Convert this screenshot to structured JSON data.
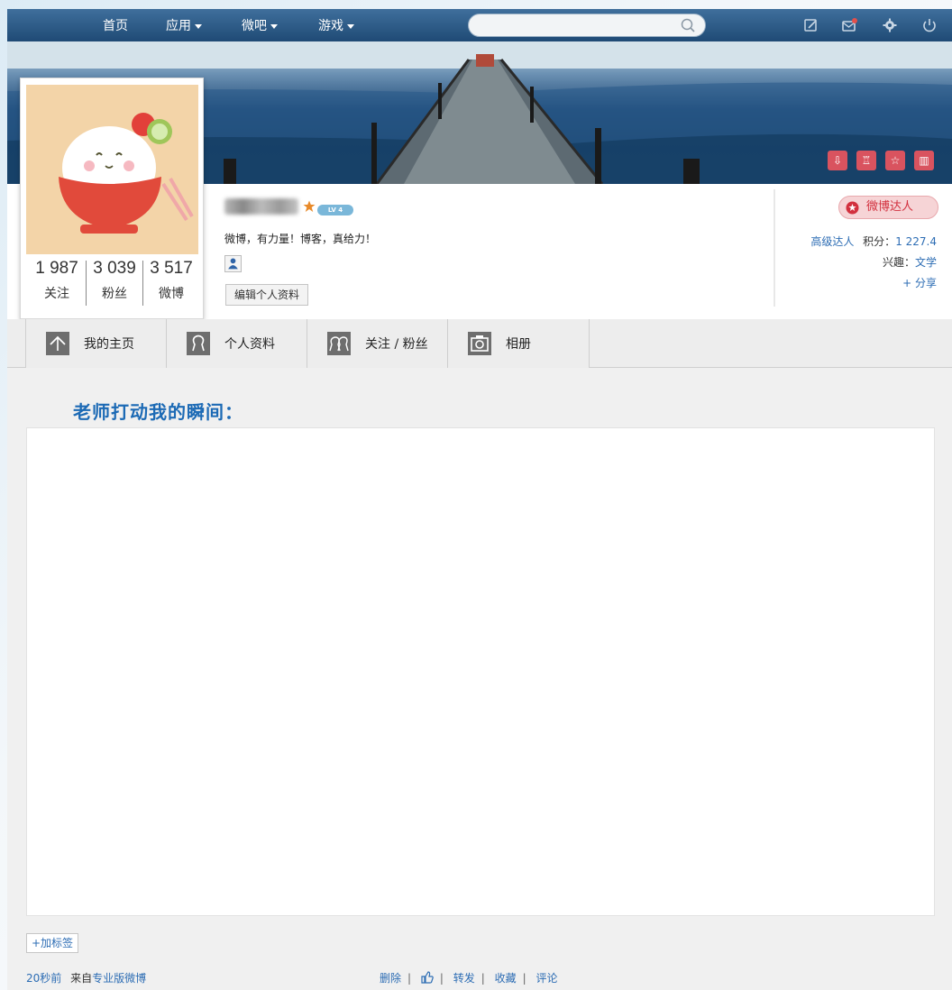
{
  "nav": {
    "items": [
      {
        "label": "首页",
        "has_caret": false
      },
      {
        "label": "应用",
        "has_caret": true
      },
      {
        "label": "微吧",
        "has_caret": true
      },
      {
        "label": "游戏",
        "has_caret": true
      }
    ],
    "search_placeholder": "",
    "tools": [
      "edit-icon",
      "messages-icon",
      "settings-icon",
      "power-icon"
    ]
  },
  "banner": {
    "badges": [
      "download-icon",
      "medal-icon",
      "star-badge-icon",
      "stats-icon"
    ]
  },
  "profile": {
    "username": "[blurred]",
    "level": "LV 4",
    "bio": "微博，有力量！博客，真给力！",
    "edit_button": "编辑个人资料",
    "stats": [
      {
        "value": "1 987",
        "label": "关注"
      },
      {
        "value": "3 039",
        "label": "粉丝"
      },
      {
        "value": "3 517",
        "label": "微博"
      }
    ],
    "vip_badge": "微博达人",
    "rank_label": "高级达人",
    "points_label": "积分：",
    "points_value": "1 227.4",
    "interest_label": "兴趣：",
    "interest_value": "文学",
    "share_label": "+ 分享"
  },
  "tabs": [
    {
      "label": "我的主页",
      "icon": "home-icon"
    },
    {
      "label": "个人资料",
      "icon": "profile-icon"
    },
    {
      "label": "关注 / 粉丝",
      "icon": "follow-icon"
    },
    {
      "label": "相册",
      "icon": "camera-icon"
    }
  ],
  "post": {
    "heading": "老师打动我的瞬间：",
    "add_tag": "+加标签",
    "time": "20秒前",
    "from_prefix": "来自",
    "source": "专业版微博",
    "actions": {
      "delete": "删除",
      "repost": "转发",
      "favorite": "收藏",
      "comment": "评论"
    }
  },
  "colors": {
    "nav_bg": "#2a5884",
    "link": "#2d6db4",
    "heading": "#1c6ab5",
    "badge_red": "#d9535f"
  }
}
